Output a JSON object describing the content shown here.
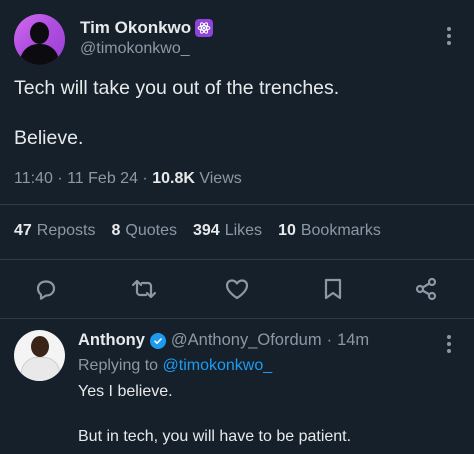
{
  "post": {
    "author_name": "Tim Okonkwo",
    "author_handle": "@timokonkwo_",
    "text_line1": "Tech will take you out of the trenches.",
    "text_line2": "Believe.",
    "time": "11:40",
    "date": "11 Feb 24",
    "views_count": "10.8K",
    "views_label": "Views"
  },
  "stats": [
    {
      "count": "47",
      "label": "Reposts"
    },
    {
      "count": "8",
      "label": "Quotes"
    },
    {
      "count": "394",
      "label": "Likes"
    },
    {
      "count": "10",
      "label": "Bookmarks"
    }
  ],
  "reply": {
    "author_name": "Anthony",
    "author_handle": "@Anthony_Ofordum",
    "age": "14m",
    "replying_prefix": "Replying to",
    "replying_handle": "@timokonkwo_",
    "text_line1": "Yes I believe.",
    "text_line2": "But in tech, you will have to be patient."
  },
  "colors": {
    "background": "#15202b",
    "text_primary": "#e7e9ea",
    "text_secondary": "#8b98a5",
    "link": "#1d9bf0"
  },
  "icons": [
    "atom-badge-icon",
    "more-icon",
    "reply-icon",
    "repost-icon",
    "like-icon",
    "bookmark-icon",
    "share-icon",
    "verified-icon"
  ]
}
